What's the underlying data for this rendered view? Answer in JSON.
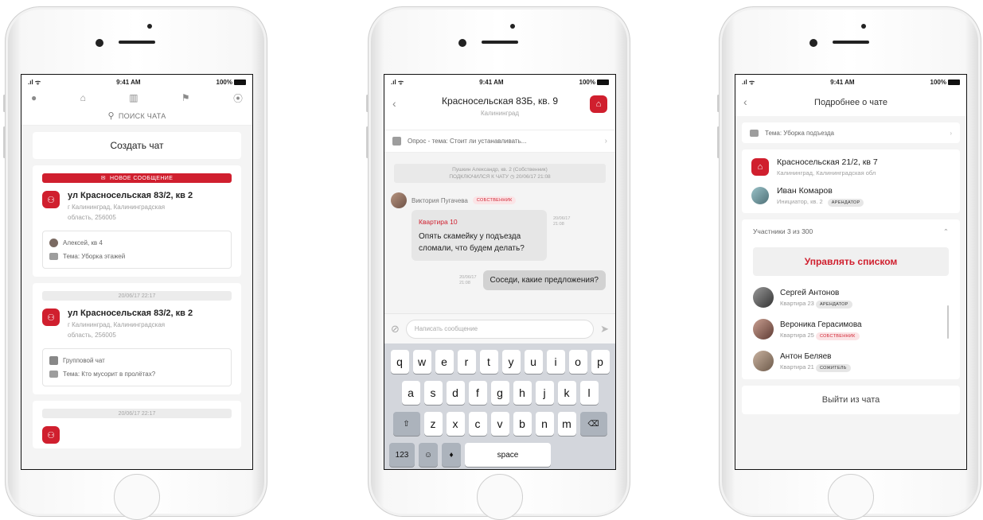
{
  "status": {
    "time": "9:41 AM",
    "battery": "100%"
  },
  "screen1": {
    "search_placeholder": "ПОИСК ЧАТА",
    "create_chat": "Создать чат",
    "chats": [
      {
        "banner": "НОВОЕ СООБЩЕНИЕ",
        "title": "ул Красносельская 83/2, кв 2",
        "address_line1": "г Калининград, Калининградская",
        "address_line2": "область, 256005",
        "author": "Алексей, кв 4",
        "topic": "Тема: Уборка этажей"
      },
      {
        "date": "20/06/17 22:17",
        "title": "ул Красносельская 83/2, кв 2",
        "address_line1": "г Калининград, Калининградская",
        "address_line2": "область, 256005",
        "author": "Групповой чат",
        "topic": "Тема: Кто мусорит в пролётах?"
      },
      {
        "date": "20/06/17 22:17"
      }
    ]
  },
  "screen2": {
    "title": "Красносельская 83Б, кв. 9",
    "subtitle": "Калининград",
    "poll": "Опрос - тема: Стоит ли устанавливать...",
    "system_line1": "Пушкин Александр, кв. 2 (Собственник)",
    "system_line2": "ПОДКЛЮЧИЛСЯ К ЧАТУ ◷ 20/06/17 21:08",
    "author": "Виктория Пугачева",
    "author_badge": "СОБСТВЕННИК",
    "incoming": {
      "quote": "Квартира 10",
      "text": "Опять скамейку у подъезда сломали, что будем делать?",
      "date": "20/06/17",
      "time": "21:08"
    },
    "outgoing": {
      "text": "Соседи, какие предложения?",
      "date": "20/06/17",
      "time": "21:08"
    },
    "input_placeholder": "Написать сообщение",
    "keyboard": {
      "row1": [
        "q",
        "w",
        "e",
        "r",
        "t",
        "y",
        "u",
        "i",
        "o",
        "p"
      ],
      "row2": [
        "a",
        "s",
        "d",
        "f",
        "g",
        "h",
        "j",
        "k",
        "l"
      ],
      "row3": [
        "z",
        "x",
        "c",
        "v",
        "b",
        "n",
        "m"
      ],
      "numbers": "123",
      "space": "space"
    }
  },
  "screen3": {
    "title": "Подробнее о чате",
    "topic": "Тема: Уборка подъезда",
    "address_title": "Красносельская 21/2, кв 7",
    "address_sub": "Калининград, Калининградская обл",
    "initiator_name": "Иван Комаров",
    "initiator_sub": "Инициатор, кв. 2",
    "initiator_badge": "АРЕНДАТОР",
    "participants": "Участники 3 из 300",
    "manage": "Управлять списком",
    "members": [
      {
        "name": "Сергей Антонов",
        "apt": "Квартира 23",
        "badge": "АРЕНДАТОР",
        "badge_style": "dark"
      },
      {
        "name": "Вероника Герасимова",
        "apt": "Квартира 25",
        "badge": "СОБСТВЕННИК",
        "badge_style": "red"
      },
      {
        "name": "Антон Беляев",
        "apt": "Квартира 21",
        "badge": "СОЖИТЕЛЬ",
        "badge_style": "dark"
      }
    ],
    "leave": "Выйти из чата"
  },
  "colors": {
    "accent": "#d01f2e",
    "background": "#f4f4f4"
  },
  "icons": [
    "check-circle-icon",
    "home-icon",
    "buildings-icon",
    "flag-icon",
    "location-pin-icon",
    "search-icon",
    "message-icon",
    "group-icon",
    "back-icon",
    "attach-icon",
    "send-icon"
  ]
}
